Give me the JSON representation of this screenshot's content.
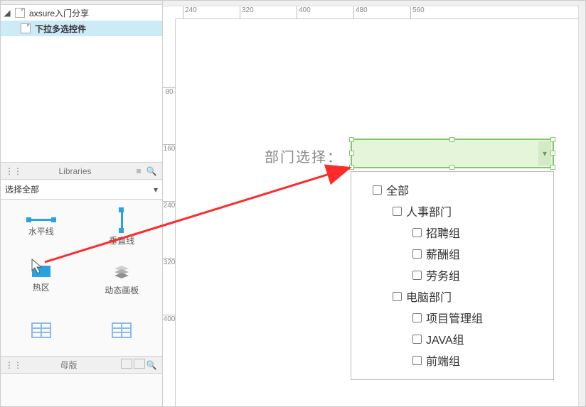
{
  "outline": {
    "root": "axsure入门分享",
    "selected": "下拉多选控件"
  },
  "libraries": {
    "title": "Libraries",
    "select": "选择全部",
    "items": [
      "水平线",
      "垂直线",
      "热区",
      "动态画板"
    ]
  },
  "masters": {
    "title": "母版"
  },
  "ruler_h": [
    "240",
    "320",
    "400",
    "480",
    "560"
  ],
  "ruler_v": [
    "80",
    "160",
    "240",
    "320",
    "400"
  ],
  "canvas": {
    "label": "部门选择：",
    "tree": [
      {
        "label": "全部",
        "indent": 1
      },
      {
        "label": "人事部门",
        "indent": 2
      },
      {
        "label": "招聘组",
        "indent": 3
      },
      {
        "label": "薪酬组",
        "indent": 3
      },
      {
        "label": "劳务组",
        "indent": 3
      },
      {
        "label": "电脑部门",
        "indent": 2
      },
      {
        "label": "项目管理组",
        "indent": 3
      },
      {
        "label": "JAVA组",
        "indent": 3
      },
      {
        "label": "前端组",
        "indent": 3
      }
    ]
  }
}
